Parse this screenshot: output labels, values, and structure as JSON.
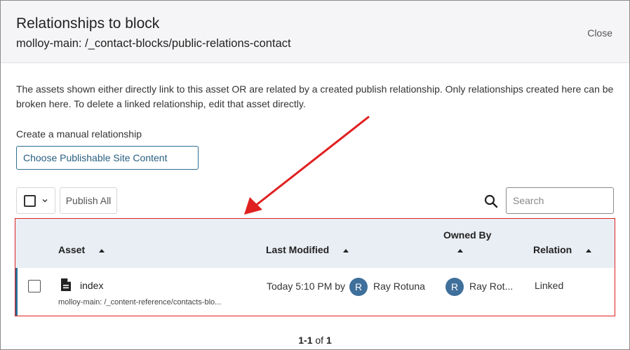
{
  "header": {
    "title": "Relationships to block",
    "subtitle": "molloy-main: /_contact-blocks/public-relations-contact",
    "close_label": "Close"
  },
  "description": "The assets shown either directly link to this asset OR are related by a created publish relationship. Only relationships created here can be broken here. To delete a linked relationship, edit that asset directly.",
  "create_section": {
    "label": "Create a manual relationship",
    "button_label": "Choose Publishable Site Content"
  },
  "toolbar": {
    "publish_all_label": "Publish All",
    "search_placeholder": "Search"
  },
  "table": {
    "columns": {
      "asset": "Asset",
      "last_modified": "Last Modified",
      "owned_by": "Owned By",
      "relation": "Relation"
    },
    "rows": [
      {
        "asset_name": "index",
        "asset_path": "molloy-main: /_content-reference/contacts-blo...",
        "last_modified": "Today 5:10 PM by",
        "modified_by_initial": "R",
        "modified_by": "Ray Rotuna",
        "owner_initial": "R",
        "owner": "Ray Rot...",
        "relation": "Linked"
      }
    ]
  },
  "pagination": {
    "range": "1-1",
    "of_label": "of",
    "total": "1"
  },
  "colors": {
    "accent": "#2b6e97",
    "annotation": "#e02020",
    "avatar": "#3f6f9b"
  }
}
